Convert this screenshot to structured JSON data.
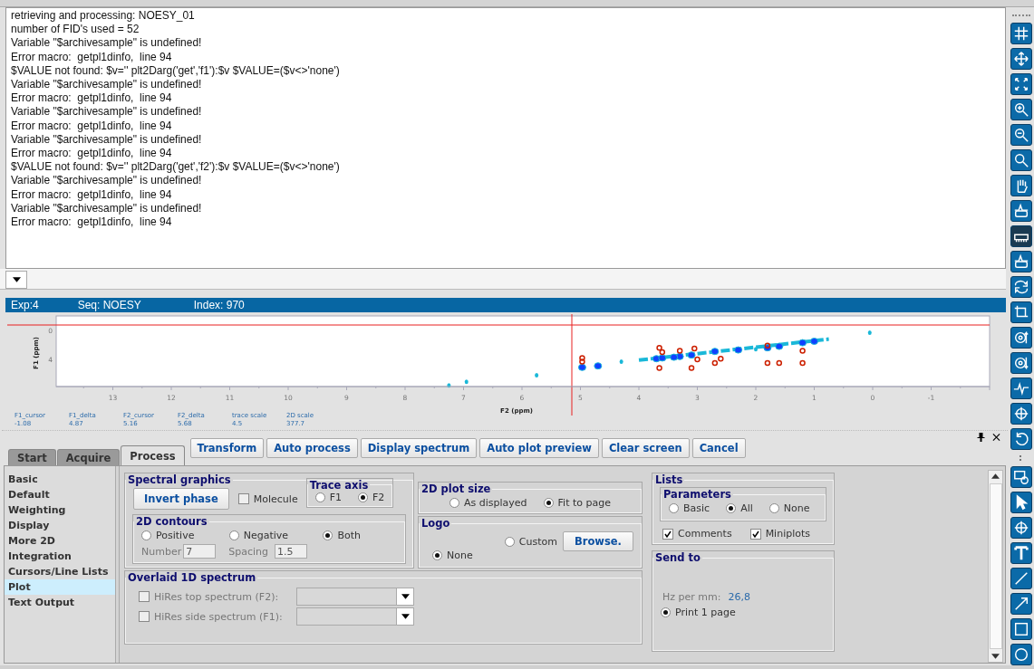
{
  "log_lines": [
    "retrieving and processing: NOESY_01",
    "number of FID's used = 52",
    "Variable \"$archivesample\" is undefined!",
    "Error macro:  getpl1dinfo,  line 94",
    "$VALUE not found: $v='' plt2Darg('get','f1'):$v $VALUE=($v<>'none')",
    "Variable \"$archivesample\" is undefined!",
    "Error macro:  getpl1dinfo,  line 94",
    "Variable \"$archivesample\" is undefined!",
    "Error macro:  getpl1dinfo,  line 94",
    "Variable \"$archivesample\" is undefined!",
    "Error macro:  getpl1dinfo,  line 94",
    "$VALUE not found: $v='' plt2Darg('get','f2'):$v $VALUE=($v<>'none')",
    "Variable \"$archivesample\" is undefined!",
    "Error macro:  getpl1dinfo,  line 94",
    "Variable \"$archivesample\" is undefined!",
    "Error macro:  getpl1dinfo,  line 94"
  ],
  "spectrum_header": {
    "exp": "Exp:4",
    "seq": "Seq: NOESY",
    "index": "Index: 970"
  },
  "plot": {
    "y_label": "F1 (ppm)",
    "x_label": "F2 (ppm)",
    "x_ticks": [
      "13",
      "12",
      "11",
      "10",
      "9",
      "8",
      "7",
      "6",
      "5",
      "4",
      "3",
      "2",
      "1",
      "0",
      "-1"
    ],
    "y_ticks": [
      "0",
      "4"
    ],
    "readouts": [
      {
        "label": "F1_cursor",
        "value": "-1.08"
      },
      {
        "label": "F1_delta",
        "value": "4.87"
      },
      {
        "label": "F2_cursor",
        "value": "5.16"
      },
      {
        "label": "F2_delta",
        "value": "5.68"
      },
      {
        "label": "trace scale",
        "value": "4.5"
      },
      {
        "label": "2D scale",
        "value": "377.7"
      }
    ]
  },
  "tabs": [
    {
      "label": "Start",
      "selected": false
    },
    {
      "label": "Acquire",
      "selected": false
    },
    {
      "label": "Process",
      "selected": true
    }
  ],
  "actions": [
    "Transform",
    "Auto process",
    "Display spectrum",
    "Auto plot preview",
    "Clear screen",
    "Cancel"
  ],
  "categories": [
    {
      "label": "Basic",
      "selected": false
    },
    {
      "label": "Default",
      "selected": false
    },
    {
      "label": "Weighting",
      "selected": false
    },
    {
      "label": "Display",
      "selected": false
    },
    {
      "label": "More 2D",
      "selected": false
    },
    {
      "label": "Integration",
      "selected": false
    },
    {
      "label": "Cursors/Line Lists",
      "selected": false
    },
    {
      "label": "Plot",
      "selected": true
    },
    {
      "label": "Text Output",
      "selected": false
    }
  ],
  "spectral_graphics": {
    "title": "Spectral graphics",
    "invert_button": "Invert phase",
    "molecule": {
      "label": "Molecule",
      "checked": false
    },
    "trace_axis": {
      "title": "Trace axis",
      "options": [
        {
          "label": "F1",
          "selected": false
        },
        {
          "label": "F2",
          "selected": true
        }
      ]
    },
    "contours": {
      "title": "2D contours",
      "options": [
        {
          "label": "Positive",
          "selected": false
        },
        {
          "label": "Negative",
          "selected": false
        },
        {
          "label": "Both",
          "selected": true
        }
      ],
      "number_label": "Number",
      "number_value": "7",
      "spacing_label": "Spacing",
      "spacing_value": "1.5"
    }
  },
  "plot_size": {
    "title": "2D plot size",
    "options": [
      {
        "label": "As displayed",
        "selected": false
      },
      {
        "label": "Fit to page",
        "selected": true
      }
    ]
  },
  "logo": {
    "title": "Logo",
    "custom": {
      "label": "Custom",
      "selected": false
    },
    "browse_button": "Browse.",
    "none": {
      "label": "None",
      "selected": true
    }
  },
  "overlaid": {
    "title": "Overlaid 1D spectrum",
    "rows": [
      {
        "label": "HiRes top spectrum (F2):",
        "checked": false
      },
      {
        "label": "HiRes side spectrum (F1):",
        "checked": false
      }
    ]
  },
  "lists": {
    "title": "Lists",
    "parameters": {
      "title": "Parameters",
      "options": [
        {
          "label": "Basic",
          "selected": false
        },
        {
          "label": "All",
          "selected": true
        },
        {
          "label": "None",
          "selected": false
        }
      ]
    },
    "checks": [
      {
        "label": "Comments",
        "checked": true
      },
      {
        "label": "Miniplots",
        "checked": true
      }
    ]
  },
  "send_to": {
    "title": "Send to",
    "hz_label": "Hz per mm:",
    "hz_value": "26,8",
    "options": [
      {
        "label": "Print 1 page",
        "selected": true
      }
    ]
  }
}
